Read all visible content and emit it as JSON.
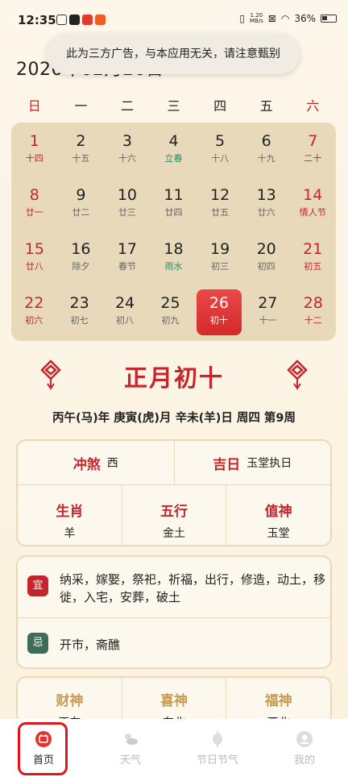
{
  "status_bar": {
    "time": "12:35",
    "net_speed_top": "1.20",
    "net_speed_bottom": "MB/s",
    "battery": "36%"
  },
  "toast": "此为三方广告，与本应用无关，请注意甄别",
  "date_title": "2026年02月26日",
  "weekdays": [
    "日",
    "一",
    "二",
    "三",
    "四",
    "五",
    "六"
  ],
  "calendar": [
    [
      {
        "d": "1",
        "l": "十四"
      },
      {
        "d": "2",
        "l": "十五"
      },
      {
        "d": "3",
        "l": "十六"
      },
      {
        "d": "4",
        "l": "立春"
      },
      {
        "d": "5",
        "l": "十八"
      },
      {
        "d": "6",
        "l": "十九"
      },
      {
        "d": "7",
        "l": "二十"
      }
    ],
    [
      {
        "d": "8",
        "l": "廿一"
      },
      {
        "d": "9",
        "l": "廿二"
      },
      {
        "d": "10",
        "l": "廿三"
      },
      {
        "d": "11",
        "l": "廿四"
      },
      {
        "d": "12",
        "l": "廿五"
      },
      {
        "d": "13",
        "l": "廿六"
      },
      {
        "d": "14",
        "l": "情人节"
      }
    ],
    [
      {
        "d": "15",
        "l": "廿八"
      },
      {
        "d": "16",
        "l": "除夕"
      },
      {
        "d": "17",
        "l": "春节"
      },
      {
        "d": "18",
        "l": "雨水"
      },
      {
        "d": "19",
        "l": "初三"
      },
      {
        "d": "20",
        "l": "初四"
      },
      {
        "d": "21",
        "l": "初五"
      }
    ],
    [
      {
        "d": "22",
        "l": "初六"
      },
      {
        "d": "23",
        "l": "初七"
      },
      {
        "d": "24",
        "l": "初八"
      },
      {
        "d": "25",
        "l": "初九"
      },
      {
        "d": "26",
        "l": "初十"
      },
      {
        "d": "27",
        "l": "十一"
      },
      {
        "d": "28",
        "l": "十二"
      }
    ]
  ],
  "lunar_title": "正月初十",
  "ganzhi": "丙午(马)年 庚寅(虎)月 辛未(羊)日 周四 第9周",
  "info": {
    "chongsha_label": "冲煞",
    "chongsha_value": "西",
    "jiri_label": "吉日",
    "jiri_value": "玉堂执日",
    "shengxiao_label": "生肖",
    "shengxiao_value": "羊",
    "wuxing_label": "五行",
    "wuxing_value": "金土",
    "zhishen_label": "值神",
    "zhishen_value": "玉堂"
  },
  "yiji": {
    "yi_badge": "宜",
    "yi_text": "纳采，嫁娶，祭祀，祈福，出行，修造，动土，移徙，入宅，安葬，破土",
    "ji_badge": "忌",
    "ji_text": "开市，斋醮"
  },
  "gods": {
    "caishen_label": "财神",
    "caishen_value": "正东",
    "xishen_label": "喜神",
    "xishen_value": "东北",
    "fushen_label": "福神",
    "fushen_value": "西北"
  },
  "nav": [
    {
      "label": "首页"
    },
    {
      "label": "天气"
    },
    {
      "label": "节日节气"
    },
    {
      "label": "我的"
    }
  ],
  "colors": {
    "accent_red": "#c4262e",
    "gold": "#c99a52",
    "term_green": "#2f8a6d"
  }
}
